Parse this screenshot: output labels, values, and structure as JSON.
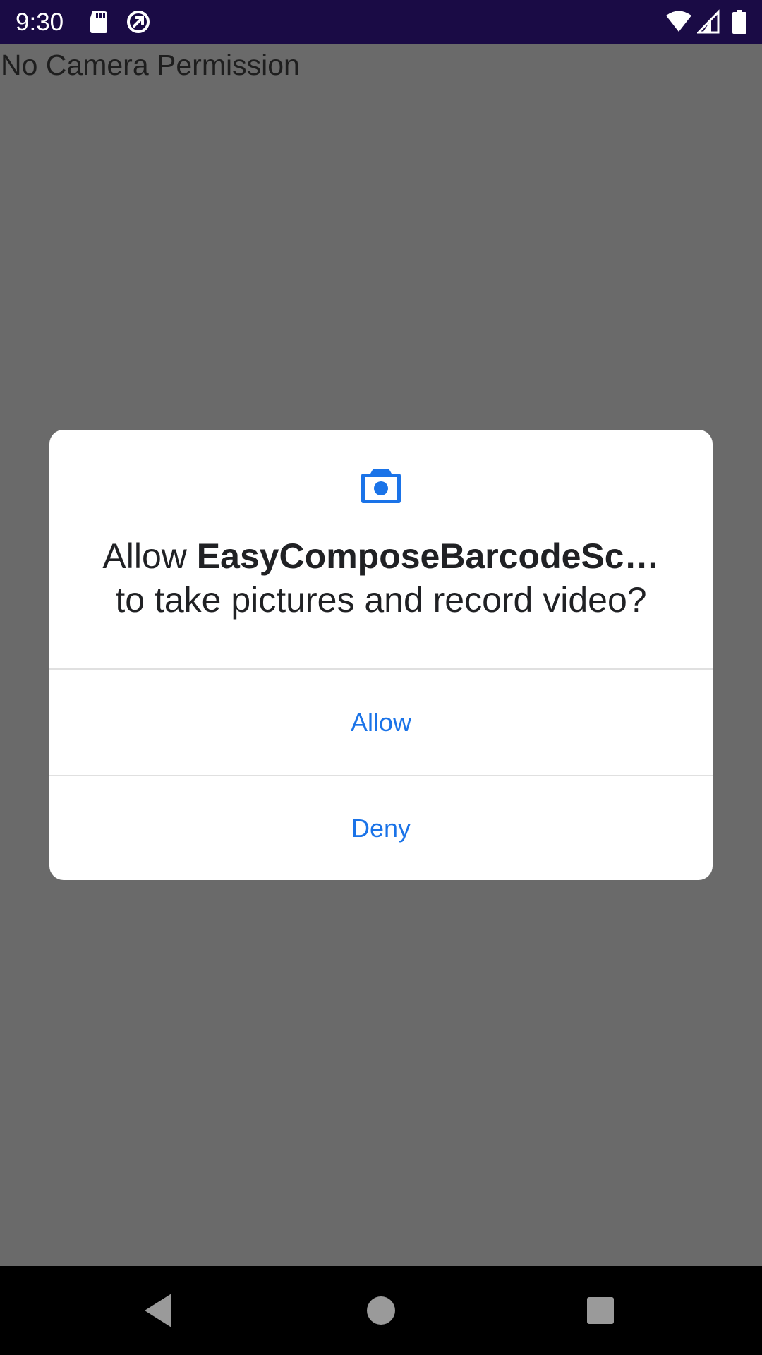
{
  "status_bar": {
    "time": "9:30",
    "icons_left": [
      "sd-card-icon",
      "circle-at-icon"
    ],
    "icons_right": [
      "wifi-icon",
      "signal-icon",
      "battery-icon"
    ],
    "background": "#1a0b45"
  },
  "app": {
    "message": "No Camera Permission"
  },
  "dialog": {
    "icon": "camera-icon",
    "message_prefix": "Allow ",
    "app_name": "EasyComposeBarcodeSc…",
    "message_suffix": "to take pictures and record video?",
    "allow_label": "Allow",
    "deny_label": "Deny",
    "accent_color": "#1a73e8"
  },
  "nav_bar": {
    "buttons": [
      "back-icon",
      "home-icon",
      "recents-icon"
    ]
  }
}
